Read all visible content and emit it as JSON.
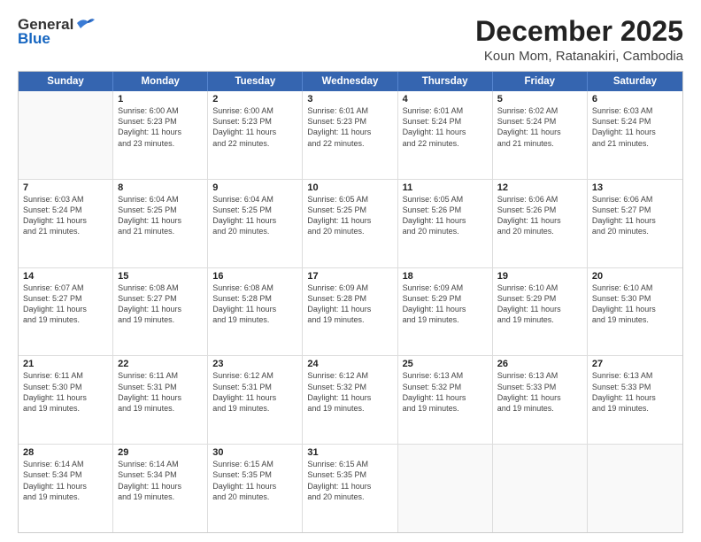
{
  "header": {
    "logo_general": "General",
    "logo_blue": "Blue",
    "main_title": "December 2025",
    "subtitle": "Koun Mom, Ratanakiri, Cambodia"
  },
  "weekdays": [
    "Sunday",
    "Monday",
    "Tuesday",
    "Wednesday",
    "Thursday",
    "Friday",
    "Saturday"
  ],
  "weeks": [
    [
      {
        "day": "",
        "lines": []
      },
      {
        "day": "1",
        "lines": [
          "Sunrise: 6:00 AM",
          "Sunset: 5:23 PM",
          "Daylight: 11 hours",
          "and 23 minutes."
        ]
      },
      {
        "day": "2",
        "lines": [
          "Sunrise: 6:00 AM",
          "Sunset: 5:23 PM",
          "Daylight: 11 hours",
          "and 22 minutes."
        ]
      },
      {
        "day": "3",
        "lines": [
          "Sunrise: 6:01 AM",
          "Sunset: 5:23 PM",
          "Daylight: 11 hours",
          "and 22 minutes."
        ]
      },
      {
        "day": "4",
        "lines": [
          "Sunrise: 6:01 AM",
          "Sunset: 5:24 PM",
          "Daylight: 11 hours",
          "and 22 minutes."
        ]
      },
      {
        "day": "5",
        "lines": [
          "Sunrise: 6:02 AM",
          "Sunset: 5:24 PM",
          "Daylight: 11 hours",
          "and 21 minutes."
        ]
      },
      {
        "day": "6",
        "lines": [
          "Sunrise: 6:03 AM",
          "Sunset: 5:24 PM",
          "Daylight: 11 hours",
          "and 21 minutes."
        ]
      }
    ],
    [
      {
        "day": "7",
        "lines": [
          "Sunrise: 6:03 AM",
          "Sunset: 5:24 PM",
          "Daylight: 11 hours",
          "and 21 minutes."
        ]
      },
      {
        "day": "8",
        "lines": [
          "Sunrise: 6:04 AM",
          "Sunset: 5:25 PM",
          "Daylight: 11 hours",
          "and 21 minutes."
        ]
      },
      {
        "day": "9",
        "lines": [
          "Sunrise: 6:04 AM",
          "Sunset: 5:25 PM",
          "Daylight: 11 hours",
          "and 20 minutes."
        ]
      },
      {
        "day": "10",
        "lines": [
          "Sunrise: 6:05 AM",
          "Sunset: 5:25 PM",
          "Daylight: 11 hours",
          "and 20 minutes."
        ]
      },
      {
        "day": "11",
        "lines": [
          "Sunrise: 6:05 AM",
          "Sunset: 5:26 PM",
          "Daylight: 11 hours",
          "and 20 minutes."
        ]
      },
      {
        "day": "12",
        "lines": [
          "Sunrise: 6:06 AM",
          "Sunset: 5:26 PM",
          "Daylight: 11 hours",
          "and 20 minutes."
        ]
      },
      {
        "day": "13",
        "lines": [
          "Sunrise: 6:06 AM",
          "Sunset: 5:27 PM",
          "Daylight: 11 hours",
          "and 20 minutes."
        ]
      }
    ],
    [
      {
        "day": "14",
        "lines": [
          "Sunrise: 6:07 AM",
          "Sunset: 5:27 PM",
          "Daylight: 11 hours",
          "and 19 minutes."
        ]
      },
      {
        "day": "15",
        "lines": [
          "Sunrise: 6:08 AM",
          "Sunset: 5:27 PM",
          "Daylight: 11 hours",
          "and 19 minutes."
        ]
      },
      {
        "day": "16",
        "lines": [
          "Sunrise: 6:08 AM",
          "Sunset: 5:28 PM",
          "Daylight: 11 hours",
          "and 19 minutes."
        ]
      },
      {
        "day": "17",
        "lines": [
          "Sunrise: 6:09 AM",
          "Sunset: 5:28 PM",
          "Daylight: 11 hours",
          "and 19 minutes."
        ]
      },
      {
        "day": "18",
        "lines": [
          "Sunrise: 6:09 AM",
          "Sunset: 5:29 PM",
          "Daylight: 11 hours",
          "and 19 minutes."
        ]
      },
      {
        "day": "19",
        "lines": [
          "Sunrise: 6:10 AM",
          "Sunset: 5:29 PM",
          "Daylight: 11 hours",
          "and 19 minutes."
        ]
      },
      {
        "day": "20",
        "lines": [
          "Sunrise: 6:10 AM",
          "Sunset: 5:30 PM",
          "Daylight: 11 hours",
          "and 19 minutes."
        ]
      }
    ],
    [
      {
        "day": "21",
        "lines": [
          "Sunrise: 6:11 AM",
          "Sunset: 5:30 PM",
          "Daylight: 11 hours",
          "and 19 minutes."
        ]
      },
      {
        "day": "22",
        "lines": [
          "Sunrise: 6:11 AM",
          "Sunset: 5:31 PM",
          "Daylight: 11 hours",
          "and 19 minutes."
        ]
      },
      {
        "day": "23",
        "lines": [
          "Sunrise: 6:12 AM",
          "Sunset: 5:31 PM",
          "Daylight: 11 hours",
          "and 19 minutes."
        ]
      },
      {
        "day": "24",
        "lines": [
          "Sunrise: 6:12 AM",
          "Sunset: 5:32 PM",
          "Daylight: 11 hours",
          "and 19 minutes."
        ]
      },
      {
        "day": "25",
        "lines": [
          "Sunrise: 6:13 AM",
          "Sunset: 5:32 PM",
          "Daylight: 11 hours",
          "and 19 minutes."
        ]
      },
      {
        "day": "26",
        "lines": [
          "Sunrise: 6:13 AM",
          "Sunset: 5:33 PM",
          "Daylight: 11 hours",
          "and 19 minutes."
        ]
      },
      {
        "day": "27",
        "lines": [
          "Sunrise: 6:13 AM",
          "Sunset: 5:33 PM",
          "Daylight: 11 hours",
          "and 19 minutes."
        ]
      }
    ],
    [
      {
        "day": "28",
        "lines": [
          "Sunrise: 6:14 AM",
          "Sunset: 5:34 PM",
          "Daylight: 11 hours",
          "and 19 minutes."
        ]
      },
      {
        "day": "29",
        "lines": [
          "Sunrise: 6:14 AM",
          "Sunset: 5:34 PM",
          "Daylight: 11 hours",
          "and 19 minutes."
        ]
      },
      {
        "day": "30",
        "lines": [
          "Sunrise: 6:15 AM",
          "Sunset: 5:35 PM",
          "Daylight: 11 hours",
          "and 20 minutes."
        ]
      },
      {
        "day": "31",
        "lines": [
          "Sunrise: 6:15 AM",
          "Sunset: 5:35 PM",
          "Daylight: 11 hours",
          "and 20 minutes."
        ]
      },
      {
        "day": "",
        "lines": []
      },
      {
        "day": "",
        "lines": []
      },
      {
        "day": "",
        "lines": []
      }
    ]
  ]
}
